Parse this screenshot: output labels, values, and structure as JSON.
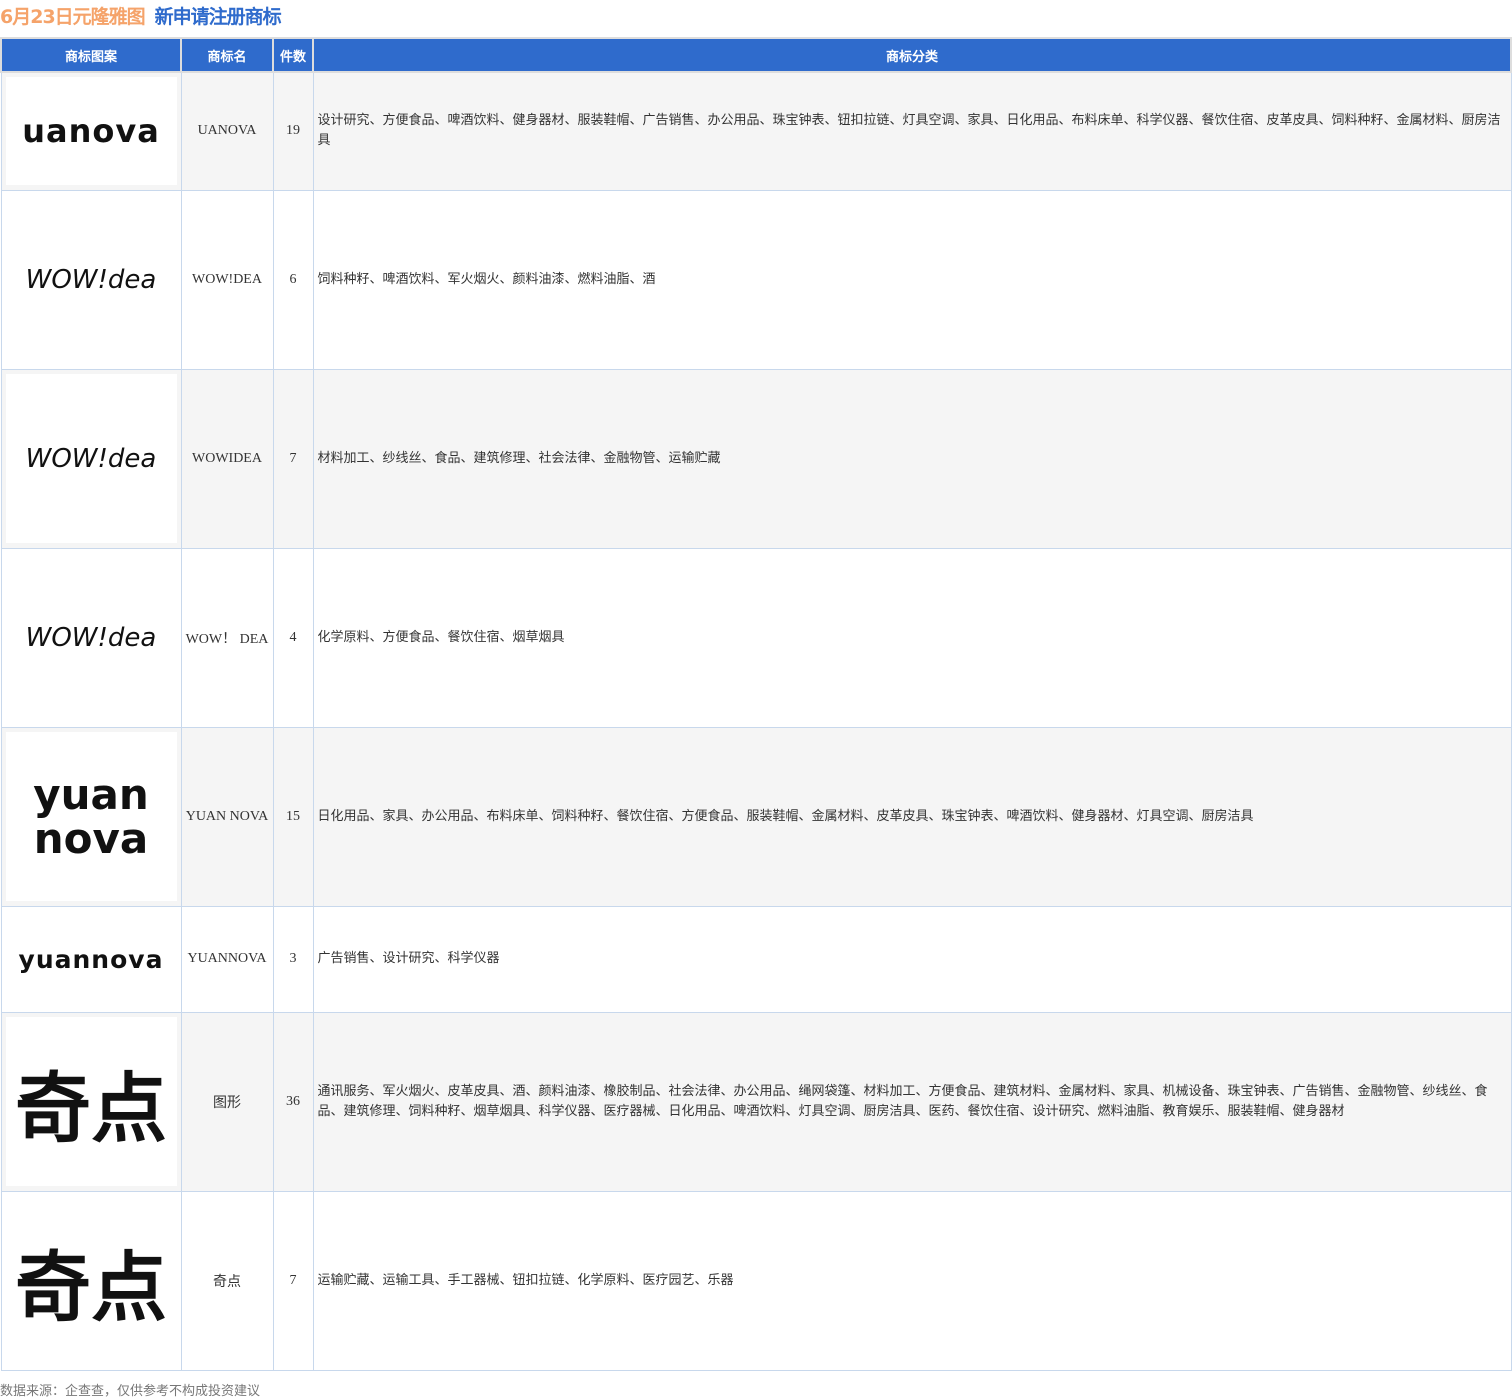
{
  "title": {
    "date_part": "6月23日元隆雅图",
    "subject": "新申请注册商标"
  },
  "headers": [
    "商标图案",
    "商标名",
    "件数",
    "商标分类"
  ],
  "rows": [
    {
      "logo": "uanova",
      "name": "UANOVA",
      "count": "19",
      "classes": "设计研究、方便食品、啤酒饮料、健身器材、服装鞋帽、广告销售、办公用品、珠宝钟表、钮扣拉链、灯具空调、家具、日化用品、布料床单、科学仪器、餐饮住宿、皮革皮具、饲料种籽、金属材料、厨房洁具"
    },
    {
      "logo": "WOW!dea",
      "name": "WOW!DEA",
      "count": "6",
      "classes": "饲料种籽、啤酒饮料、军火烟火、颜料油漆、燃料油脂、酒"
    },
    {
      "logo": "WOW!dea",
      "name": "WOWIDEA",
      "count": "7",
      "classes": "材料加工、纱线丝、食品、建筑修理、社会法律、金融物管、运输贮藏"
    },
    {
      "logo": "WOW!dea",
      "name": "WOW！ DEA",
      "count": "4",
      "classes": "化学原料、方便食品、餐饮住宿、烟草烟具"
    },
    {
      "logo": "yuan nova",
      "name": "YUAN NOVA",
      "count": "15",
      "classes": "日化用品、家具、办公用品、布料床单、饲料种籽、餐饮住宿、方便食品、服装鞋帽、金属材料、皮革皮具、珠宝钟表、啤酒饮料、健身器材、灯具空调、厨房洁具"
    },
    {
      "logo": "yuannova",
      "name": "YUANNOVA",
      "count": "3",
      "classes": "广告销售、设计研究、科学仪器"
    },
    {
      "logo": "奇点",
      "name": "图形",
      "count": "36",
      "classes": "通讯服务、军火烟火、皮革皮具、酒、颜料油漆、橡胶制品、社会法律、办公用品、绳网袋篷、材料加工、方便食品、建筑材料、金属材料、家具、机械设备、珠宝钟表、广告销售、金融物管、纱线丝、食品、建筑修理、饲料种籽、烟草烟具、科学仪器、医疗器械、日化用品、啤酒饮料、灯具空调、厨房洁具、医药、餐饮住宿、设计研究、燃料油脂、教育娱乐、服装鞋帽、健身器材"
    },
    {
      "logo": "奇点",
      "name": "奇点",
      "count": "7",
      "classes": "运输贮藏、运输工具、手工器械、钮扣拉链、化学原料、医疗园艺、乐器"
    }
  ],
  "footer": "数据来源：企查查，仅供参考不构成投资建议"
}
